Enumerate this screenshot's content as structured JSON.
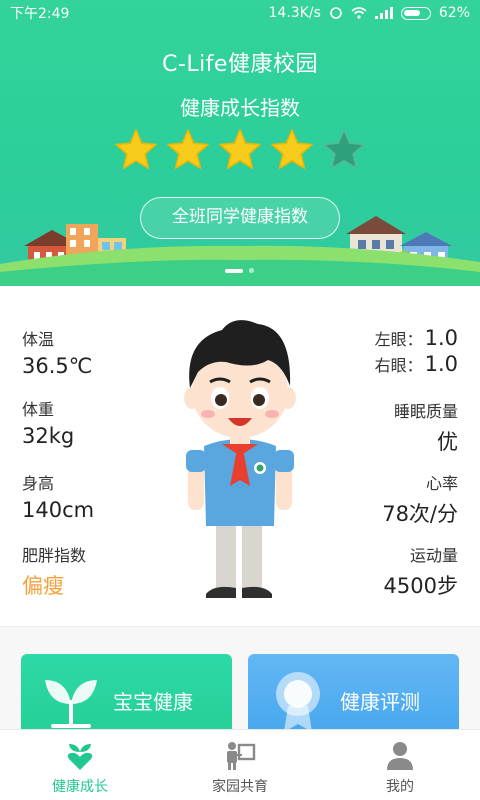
{
  "status_bar": {
    "time": "下午2:49",
    "network_speed": "14.3K/s",
    "battery": "62%"
  },
  "header": {
    "app_title": "C-Life健康校园",
    "index_title": "健康成长指数",
    "stars": {
      "rating": 4,
      "max": 5
    },
    "class_button": "全班同学健康指数",
    "carousel": {
      "pages": 2,
      "current": 1
    }
  },
  "stats": {
    "temperature": {
      "label": "体温",
      "value": "36.5℃"
    },
    "weight": {
      "label": "体重",
      "value": "32kg"
    },
    "height": {
      "label": "身高",
      "value": "140cm"
    },
    "bmi": {
      "label": "肥胖指数",
      "value": "偏瘦"
    },
    "left_eye": {
      "label": "左眼：",
      "value": "1.0"
    },
    "right_eye": {
      "label": "右眼：",
      "value": "1.0"
    },
    "sleep": {
      "label": "睡眠质量",
      "value": "优"
    },
    "heart_rate": {
      "label": "心率",
      "value": "78次/分"
    },
    "exercise": {
      "label": "运动量",
      "value": "4500步"
    }
  },
  "cards": {
    "baby_health": "宝宝健康",
    "health_eval": "健康评测"
  },
  "nav": {
    "items": [
      {
        "label": "健康成长",
        "icon": "heart-sprout-icon",
        "active": true
      },
      {
        "label": "家园共育",
        "icon": "parent-board-icon",
        "active": false
      },
      {
        "label": "我的",
        "icon": "person-icon",
        "active": false
      }
    ]
  },
  "colors": {
    "brand_green": "#2ccf9a",
    "accent_orange": "#f5a03b",
    "eval_blue": "#48a7ee",
    "star_gold": "#f8cc1c"
  }
}
